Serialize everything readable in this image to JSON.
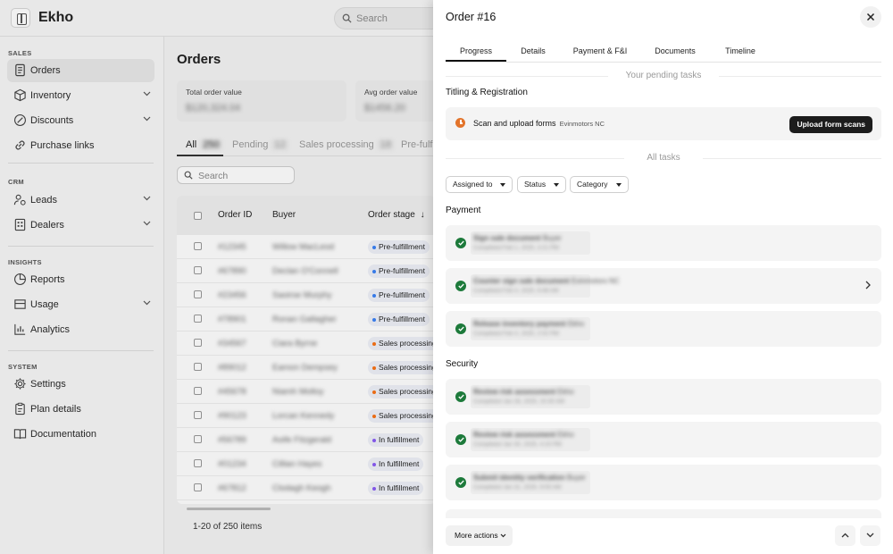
{
  "app": {
    "brand": "Ekho",
    "search_placeholder": "Search"
  },
  "sidebar": {
    "sections": [
      {
        "title": "SALES",
        "items": [
          {
            "label": "Orders",
            "icon": "orders-icon",
            "active": true,
            "expandable": false
          },
          {
            "label": "Inventory",
            "icon": "box-icon",
            "active": false,
            "expandable": true
          },
          {
            "label": "Discounts",
            "icon": "discount-icon",
            "active": false,
            "expandable": true
          },
          {
            "label": "Purchase links",
            "icon": "link-icon",
            "active": false,
            "expandable": false
          }
        ]
      },
      {
        "title": "CRM",
        "items": [
          {
            "label": "Leads",
            "icon": "leads-icon",
            "active": false,
            "expandable": true
          },
          {
            "label": "Dealers",
            "icon": "dealers-icon",
            "active": false,
            "expandable": true
          }
        ]
      },
      {
        "title": "INSIGHTS",
        "items": [
          {
            "label": "Reports",
            "icon": "reports-icon",
            "active": false,
            "expandable": false
          },
          {
            "label": "Usage",
            "icon": "usage-icon",
            "active": false,
            "expandable": true
          },
          {
            "label": "Analytics",
            "icon": "analytics-icon",
            "active": false,
            "expandable": false
          }
        ]
      },
      {
        "title": "SYSTEM",
        "items": [
          {
            "label": "Settings",
            "icon": "gear-icon",
            "active": false,
            "expandable": false
          },
          {
            "label": "Plan details",
            "icon": "plan-icon",
            "active": false,
            "expandable": false
          },
          {
            "label": "Documentation",
            "icon": "book-icon",
            "active": false,
            "expandable": false
          }
        ]
      }
    ]
  },
  "orders": {
    "title": "Orders",
    "stats": [
      {
        "label": "Total order value",
        "value": "$120,324.04"
      },
      {
        "label": "Avg order value",
        "value": "$1456.20"
      }
    ],
    "tabs": [
      {
        "label": "All",
        "count": "250"
      },
      {
        "label": "Pending",
        "count": "12"
      },
      {
        "label": "Sales processing",
        "count": "18"
      },
      {
        "label": "Pre-fulfi"
      }
    ],
    "search_placeholder": "Search",
    "columns": [
      "Order ID",
      "Buyer",
      "Order stage"
    ],
    "rows": [
      {
        "id": "#12345",
        "buyer": "Willow MacLeod",
        "stage": "Pre-fulfillment"
      },
      {
        "id": "#67890",
        "buyer": "Declan O'Connell",
        "stage": "Pre-fulfillment"
      },
      {
        "id": "#23456",
        "buyer": "Saoirse Murphy",
        "stage": "Pre-fulfillment"
      },
      {
        "id": "#78901",
        "buyer": "Ronan Gallagher",
        "stage": "Pre-fulfillment"
      },
      {
        "id": "#34567",
        "buyer": "Ciara Byrne",
        "stage": "Sales processing"
      },
      {
        "id": "#89012",
        "buyer": "Eamon Dempsey",
        "stage": "Sales processing"
      },
      {
        "id": "#45678",
        "buyer": "Niamh Molloy",
        "stage": "Sales processing"
      },
      {
        "id": "#90123",
        "buyer": "Lorcan Kennedy",
        "stage": "Sales processing"
      },
      {
        "id": "#56789",
        "buyer": "Aoife Fitzgerald",
        "stage": "In fulfillment"
      },
      {
        "id": "#01234",
        "buyer": "Cillian Hayes",
        "stage": "In fulfillment"
      },
      {
        "id": "#67812",
        "buyer": "Clodagh Keogh",
        "stage": "In fulfillment"
      }
    ],
    "pagination": "1-20 of 250 items"
  },
  "drawer": {
    "title": "Order #16",
    "tabs": [
      "Progress",
      "Details",
      "Payment & F&I",
      "Documents",
      "Timeline"
    ],
    "pending_label": "Your pending tasks",
    "pending_section": "Titling & Registration",
    "pending_task": {
      "label": "Scan and upload forms",
      "sub": "Evinmotors NC",
      "button": "Upload form scans"
    },
    "all_label": "All tasks",
    "filters": [
      "Assigned to",
      "Status",
      "Category"
    ],
    "payment": {
      "title": "Payment",
      "tasks": [
        {
          "name": "Sign sale document",
          "who": "Buyer",
          "time": "Completed Feb 1, 2025, 3:21 PM"
        },
        {
          "name": "Counter sign sale document",
          "who": "Evinmotors NC",
          "time": "Completed Feb 3, 2025, 9:48 AM"
        },
        {
          "name": "Release inventory payment",
          "who": "Ekho",
          "time": "Completed Feb 4, 2025, 2:02 PM"
        }
      ]
    },
    "security": {
      "title": "Security",
      "tasks": [
        {
          "name": "Review risk assessment",
          "who": "Ekho",
          "time": "Completed Jan 28, 2025, 10:30 AM"
        },
        {
          "name": "Review risk assessment",
          "who": "Ekho",
          "time": "Completed Jan 30, 2025, 4:15 PM"
        },
        {
          "name": "Submit identity verification",
          "who": "Buyer",
          "time": "Completed Jan 31, 2025, 9:05 AM"
        }
      ]
    },
    "more_actions": "More actions"
  },
  "colors": {
    "accent": "#1c1c1c",
    "success": "#1d7a3b",
    "pending": "#e3742b",
    "stage_pre": "#3b82f6",
    "stage_sales": "#f97316",
    "stage_in": "#8b5cf6"
  }
}
